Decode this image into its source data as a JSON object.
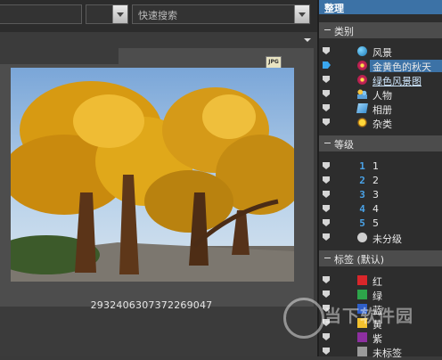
{
  "toolbar": {
    "search_label": "快速搜索"
  },
  "viewer": {
    "badge": "JPG",
    "caption": "2932406307372269047"
  },
  "panel": {
    "title": "整理",
    "categories": {
      "header": "类别",
      "items": [
        {
          "label": "风景",
          "icon": "globe-icon"
        },
        {
          "label": "金黄色的秋天",
          "icon": "flower-icon",
          "selected": true
        },
        {
          "label": "绿色风景图",
          "icon": "flower-icon",
          "link": true
        },
        {
          "label": "人物",
          "icon": "people-icon"
        },
        {
          "label": "相册",
          "icon": "album-icon"
        },
        {
          "label": "杂类",
          "icon": "sun-icon"
        }
      ]
    },
    "ratings": {
      "header": "等级",
      "items": [
        {
          "label": "1",
          "glyph": "1"
        },
        {
          "label": "2",
          "glyph": "2"
        },
        {
          "label": "3",
          "glyph": "3"
        },
        {
          "label": "4",
          "glyph": "4"
        },
        {
          "label": "5",
          "glyph": "5"
        },
        {
          "label": "未分级",
          "glyph": ""
        }
      ]
    },
    "tags": {
      "header": "标签 (默认)",
      "items": [
        {
          "label": "红",
          "color": "#d9262a"
        },
        {
          "label": "绿",
          "color": "#2da44a"
        },
        {
          "label": "蓝",
          "color": "#2f5fc9"
        },
        {
          "label": "黄",
          "color": "#f2c12e"
        },
        {
          "label": "紫",
          "color": "#8d2fa0"
        },
        {
          "label": "未标签",
          "color": "#9a9a9a"
        }
      ]
    }
  },
  "watermark": {
    "text": "当下软件园"
  }
}
